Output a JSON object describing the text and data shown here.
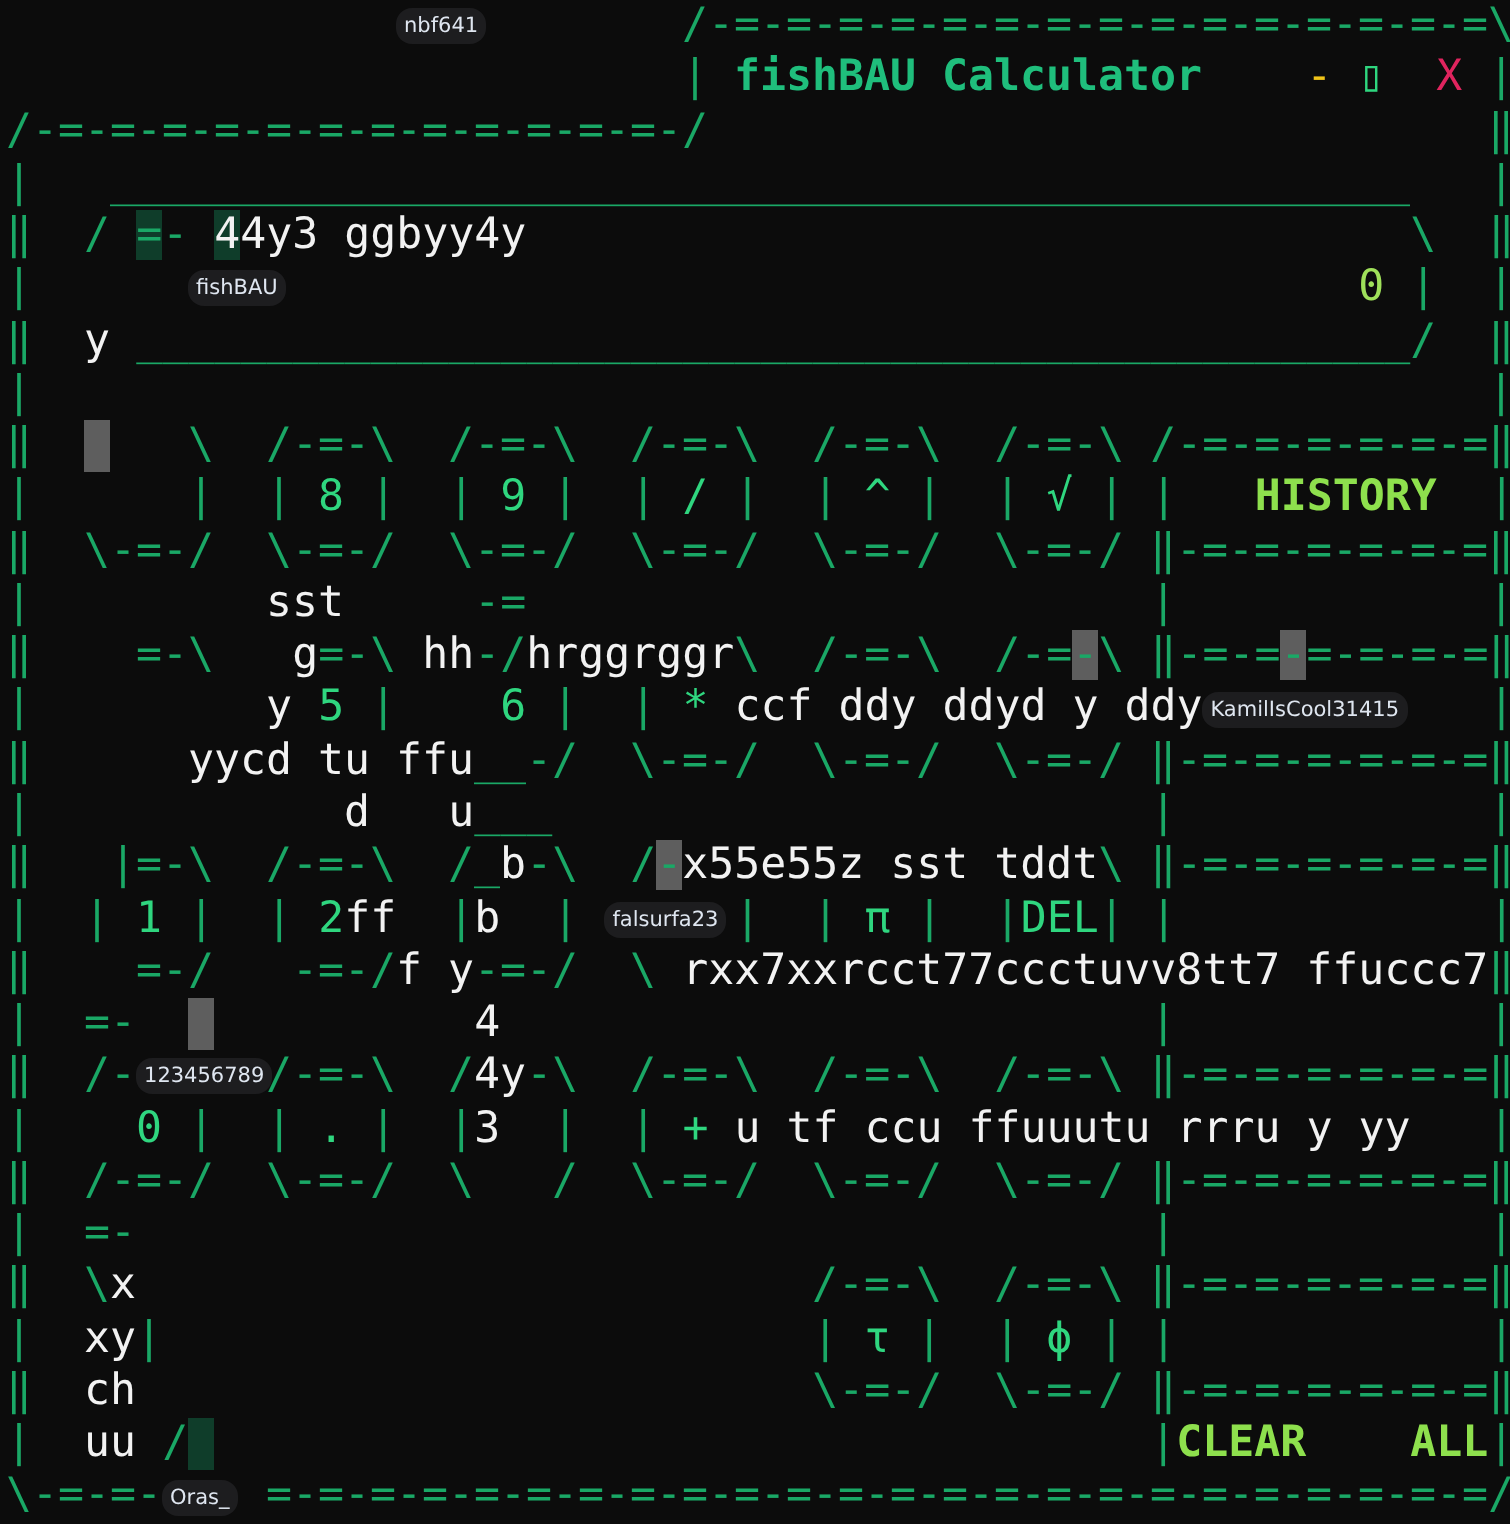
{
  "window": {
    "rows": [
      {
        "segments": [
          {
            "kind": "tag",
            "text": "               nbf641"
          },
          {
            "kind": "frame",
            "text": "           /-=-=-=-=-=-=-=-=-=-=-=-=-=-=-=\\"
          }
        ]
      },
      {
        "segments": [
          {
            "kind": "frame",
            "text": "                          |"
          },
          {
            "kind": "title",
            "text": " fishBAU Calculator"
          },
          {
            "kind": "minimize",
            "text": "    -"
          },
          {
            "kind": "maximize",
            "text": " ▯"
          },
          {
            "kind": "close",
            "text": "  X"
          },
          {
            "kind": "frame",
            "text": " |"
          }
        ]
      },
      {
        "segments": [
          {
            "kind": "frame",
            "text": "/-=-=-=-=-=-=-=-=-=-=-=-=-/"
          },
          {
            "kind": "frame",
            "text": "                              ‖"
          }
        ]
      },
      {
        "segments": [
          {
            "kind": "frame",
            "text": "|"
          },
          {
            "kind": "frame",
            "text": "   __________________________________________________"
          },
          {
            "kind": "frame",
            "text": "   |"
          }
        ]
      },
      {
        "segments": [
          {
            "kind": "frame",
            "text": "‖"
          },
          {
            "kind": "frame",
            "text": "  /"
          },
          {
            "kind": "frame-selected",
            "text": " ="
          },
          {
            "kind": "frame",
            "text": "-"
          },
          {
            "kind": "text-selected",
            "text": " 4"
          },
          {
            "kind": "text",
            "text": "4y3 ggbyy4y"
          },
          {
            "kind": "frame",
            "text": "                                  \\"
          },
          {
            "kind": "frame",
            "text": "  ‖"
          }
        ]
      },
      {
        "segments": [
          {
            "kind": "frame",
            "text": "|"
          },
          {
            "kind": "tag",
            "text": "      fishBAU"
          },
          {
            "kind": "display",
            "text": "                                             0"
          },
          {
            "kind": "frame",
            "text": " |  |"
          }
        ]
      },
      {
        "segments": [
          {
            "kind": "frame",
            "text": "‖"
          },
          {
            "kind": "text",
            "text": "  y"
          },
          {
            "kind": "frame",
            "text": " _________________________________________________/"
          },
          {
            "kind": "frame",
            "text": "  ‖"
          }
        ]
      },
      {
        "segments": [
          {
            "kind": "frame",
            "text": "|"
          },
          {
            "kind": "frame",
            "text": "                                                        |"
          }
        ]
      },
      {
        "segments": [
          {
            "kind": "frame",
            "text": "‖  "
          },
          {
            "kind": "cursor"
          },
          {
            "kind": "frame",
            "text": "   \\  /-=-\\  /-=-\\  /-=-\\  /-=-\\  /-=-\\ /-=-=-=-=-=-=‖"
          }
        ]
      },
      {
        "segments": [
          {
            "kind": "frame",
            "text": "|      |  | "
          },
          {
            "kind": "key",
            "text": "8"
          },
          {
            "kind": "frame",
            "text": " |  | "
          },
          {
            "kind": "key",
            "text": "9"
          },
          {
            "kind": "frame",
            "text": " |  | "
          },
          {
            "kind": "key",
            "text": "/"
          },
          {
            "kind": "frame",
            "text": " |  | "
          },
          {
            "kind": "key",
            "text": "^"
          },
          {
            "kind": "frame",
            "text": " |  | "
          },
          {
            "kind": "key",
            "text": "√"
          },
          {
            "kind": "frame",
            "text": " | |"
          },
          {
            "kind": "heading",
            "text": "   HISTORY"
          },
          {
            "kind": "frame",
            "text": "  |"
          }
        ]
      },
      {
        "segments": [
          {
            "kind": "frame",
            "text": "‖  \\-=-/  \\-=-/  \\-=-/  \\-=-/  \\-=-/  \\-=-/ ‖-=-=-=-=-=-=‖"
          }
        ]
      },
      {
        "segments": [
          {
            "kind": "frame",
            "text": "|"
          },
          {
            "kind": "text",
            "text": "         sst"
          },
          {
            "kind": "frame",
            "text": "     -="
          },
          {
            "kind": "frame",
            "text": "                        |            |"
          }
        ]
      },
      {
        "segments": [
          {
            "kind": "frame",
            "text": "‖"
          },
          {
            "kind": "frame",
            "text": "    =-\\"
          },
          {
            "kind": "text",
            "text": "   g"
          },
          {
            "kind": "frame",
            "text": "=-\\"
          },
          {
            "kind": "text",
            "text": " hh"
          },
          {
            "kind": "frame",
            "text": "-/"
          },
          {
            "kind": "text",
            "text": "hrggrggr"
          },
          {
            "kind": "frame",
            "text": "\\  /-=-\\  /-="
          },
          {
            "kind": "frame-cursor",
            "text": "-"
          },
          {
            "kind": "frame",
            "text": "\\ ‖-=-="
          },
          {
            "kind": "frame-cursor",
            "text": "-"
          },
          {
            "kind": "frame",
            "text": "=-=-=-=‖"
          }
        ]
      },
      {
        "segments": [
          {
            "kind": "frame",
            "text": "|"
          },
          {
            "kind": "text",
            "text": "         y"
          },
          {
            "kind": "key",
            "text": " 5"
          },
          {
            "kind": "frame",
            "text": " |    "
          },
          {
            "kind": "key",
            "text": "6"
          },
          {
            "kind": "frame",
            "text": " |  | "
          },
          {
            "kind": "key",
            "text": "*"
          },
          {
            "kind": "text",
            "text": " ccf ddy ddyd y ddy"
          },
          {
            "kind": "tag",
            "text": "KamilIsCool31415"
          },
          {
            "kind": "frame",
            "text": "           |"
          }
        ]
      },
      {
        "segments": [
          {
            "kind": "frame",
            "text": "‖"
          },
          {
            "kind": "text",
            "text": "      yycd tu ffu"
          },
          {
            "kind": "frame",
            "text": "__-/  \\-=-/  \\-=-/  \\-=-/ ‖-=-=-=-=-=-=‖"
          }
        ]
      },
      {
        "segments": [
          {
            "kind": "frame",
            "text": "|"
          },
          {
            "kind": "text",
            "text": "            d"
          },
          {
            "kind": "text",
            "text": "   u"
          },
          {
            "kind": "frame",
            "text": "___"
          },
          {
            "kind": "frame",
            "text": "                       |            |"
          }
        ]
      },
      {
        "segments": [
          {
            "kind": "frame",
            "text": "‖"
          },
          {
            "kind": "frame",
            "text": "   |=-\\  /-=-\\  /_"
          },
          {
            "kind": "text",
            "text": "b"
          },
          {
            "kind": "frame",
            "text": "-\\  /"
          },
          {
            "kind": "frame-cursor",
            "text": "-"
          },
          {
            "kind": "text",
            "text": "x55e55z sst tddt"
          },
          {
            "kind": "frame",
            "text": "\\ ‖-=-=-=-=-=-=‖"
          }
        ]
      },
      {
        "segments": [
          {
            "kind": "frame",
            "text": "|  | "
          },
          {
            "kind": "key",
            "text": "1"
          },
          {
            "kind": "frame",
            "text": " |  | "
          },
          {
            "kind": "key",
            "text": "2"
          },
          {
            "kind": "text",
            "text": "ff"
          },
          {
            "kind": "frame",
            "text": "  |"
          },
          {
            "kind": "text",
            "text": "b"
          },
          {
            "kind": "frame",
            "text": "  |"
          },
          {
            "kind": "tag",
            "text": " falsurfa23"
          },
          {
            "kind": "frame",
            "text": "     |  | "
          },
          {
            "kind": "key",
            "text": "π"
          },
          {
            "kind": "frame",
            "text": " |  |"
          },
          {
            "kind": "key",
            "text": "DEL"
          },
          {
            "kind": "frame",
            "text": "| |"
          },
          {
            "kind": "frame",
            "text": "            |"
          }
        ]
      },
      {
        "segments": [
          {
            "kind": "frame",
            "text": "‖    =-/   -=-/"
          },
          {
            "kind": "text",
            "text": "f y"
          },
          {
            "kind": "frame",
            "text": "-=-/  \\"
          },
          {
            "kind": "text",
            "text": " rxx7xxrcct77ccctuvv8tt7 ffuccc7"
          },
          {
            "kind": "frame",
            "text": "‖"
          }
        ]
      },
      {
        "segments": [
          {
            "kind": "frame",
            "text": "|"
          },
          {
            "kind": "frame",
            "text": "  =-  "
          },
          {
            "kind": "cursor"
          },
          {
            "kind": "text",
            "text": "          4"
          },
          {
            "kind": "frame",
            "text": "                         |            |"
          }
        ]
      },
      {
        "segments": [
          {
            "kind": "frame",
            "text": "‖  /-"
          },
          {
            "kind": "tag",
            "text": "123456789"
          },
          {
            "kind": "frame",
            "text": "     /-=-\\  /"
          },
          {
            "kind": "text",
            "text": "4y"
          },
          {
            "kind": "frame",
            "text": "-\\  /-=-\\  /-=-\\  /-=-\\ ‖-=-=-=-=-=-=‖"
          }
        ]
      },
      {
        "segments": [
          {
            "kind": "frame",
            "text": "|"
          },
          {
            "kind": "key",
            "text": "    0"
          },
          {
            "kind": "frame",
            "text": " |  | "
          },
          {
            "kind": "key",
            "text": "."
          },
          {
            "kind": "frame",
            "text": " |  |"
          },
          {
            "kind": "text",
            "text": "3"
          },
          {
            "kind": "frame",
            "text": "  |  | "
          },
          {
            "kind": "key",
            "text": "+"
          },
          {
            "kind": "text",
            "text": " u tf ccu ffuuutu rrru y yy"
          },
          {
            "kind": "frame",
            "text": "   |"
          }
        ]
      },
      {
        "segments": [
          {
            "kind": "frame",
            "text": "‖  /-=-/  \\-=-/  \\   /  \\-=-/  \\-=-/  \\-=-/ ‖-=-=-=-=-=-=‖"
          }
        ]
      },
      {
        "segments": [
          {
            "kind": "frame",
            "text": "|"
          },
          {
            "kind": "frame",
            "text": "  =-"
          },
          {
            "kind": "frame",
            "text": "                                       |            |"
          }
        ]
      },
      {
        "segments": [
          {
            "kind": "frame",
            "text": "‖  \\"
          },
          {
            "kind": "text",
            "text": "x"
          },
          {
            "kind": "frame",
            "text": "                          /-=-\\  /-=-\\ ‖-=-=-=-=-=-=‖"
          }
        ]
      },
      {
        "segments": [
          {
            "kind": "frame",
            "text": "|"
          },
          {
            "kind": "text",
            "text": "  xy"
          },
          {
            "kind": "frame",
            "text": "|"
          },
          {
            "kind": "frame",
            "text": "                         | "
          },
          {
            "kind": "key",
            "text": "τ"
          },
          {
            "kind": "frame",
            "text": " |  | "
          },
          {
            "kind": "key",
            "text": "ϕ"
          },
          {
            "kind": "frame",
            "text": " | |            |"
          }
        ]
      },
      {
        "segments": [
          {
            "kind": "frame",
            "text": "‖"
          },
          {
            "kind": "text",
            "text": "  ch"
          },
          {
            "kind": "frame",
            "text": "                          \\-=-/  \\-=-/ ‖-=-=-=-=-=-=‖"
          }
        ]
      },
      {
        "segments": [
          {
            "kind": "frame",
            "text": "|"
          },
          {
            "kind": "text",
            "text": "  uu"
          },
          {
            "kind": "frame",
            "text": " /"
          },
          {
            "kind": "selection"
          },
          {
            "kind": "frame",
            "text": "                                    |"
          },
          {
            "kind": "action",
            "text": "CLEAR    ALL"
          },
          {
            "kind": "frame",
            "text": "|"
          }
        ]
      },
      {
        "segments": [
          {
            "kind": "frame",
            "text": "\\-=-=-"
          },
          {
            "kind": "tag",
            "text": "Oras_"
          },
          {
            "kind": "frame",
            "text": "    =-=-=-=-=-=-=-=-=-=-=-=-=-=-=-=-=-=-=-=-=-=-=-=/"
          }
        ]
      }
    ]
  }
}
